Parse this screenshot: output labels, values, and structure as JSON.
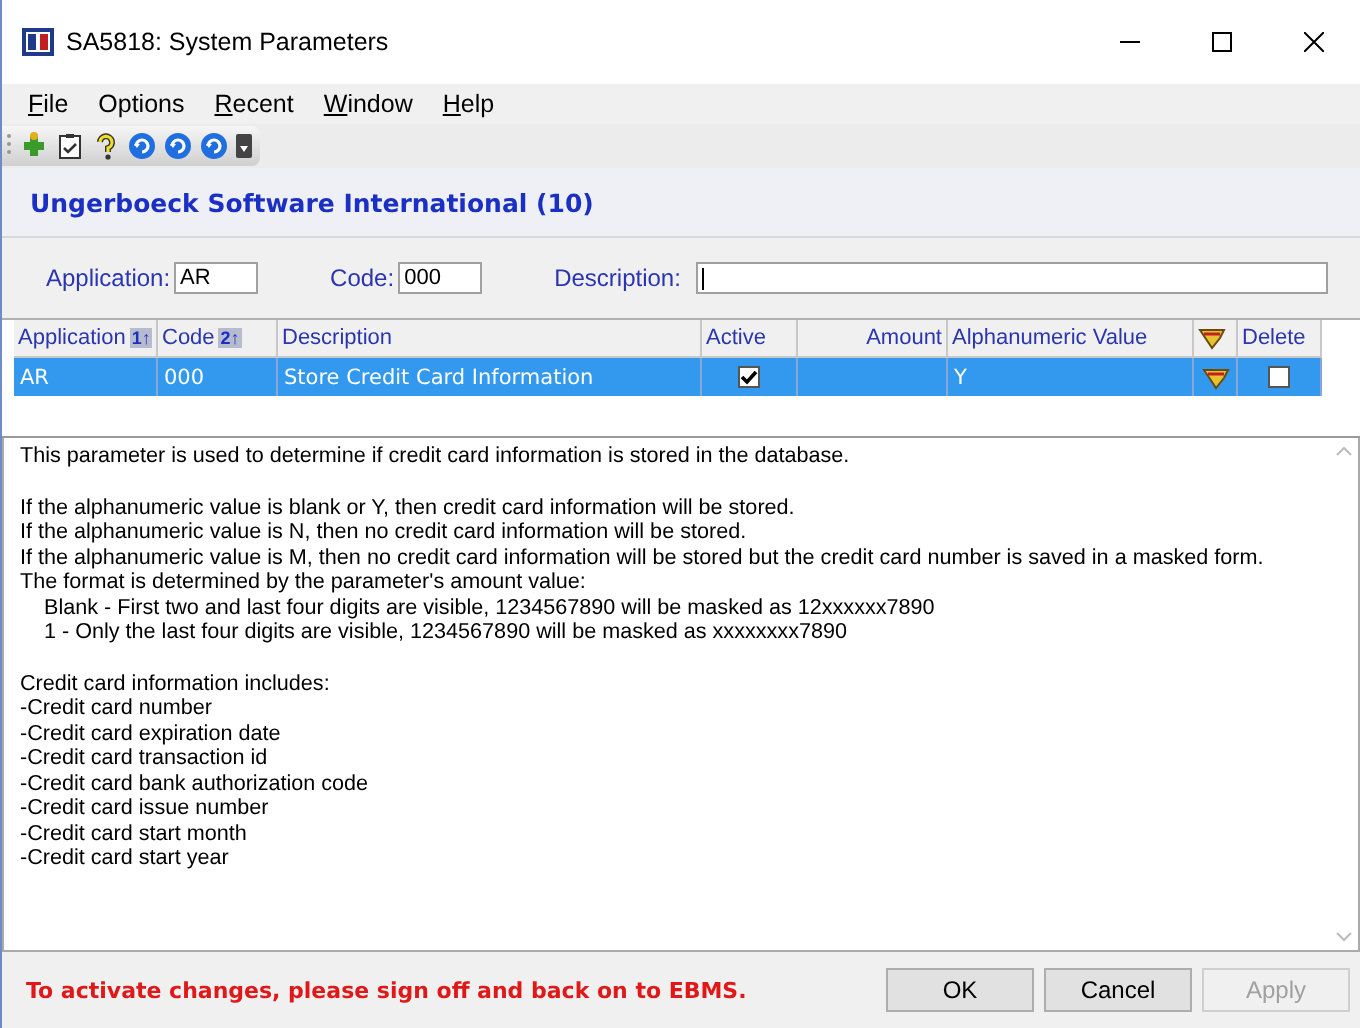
{
  "window": {
    "title": "SA5818: System Parameters"
  },
  "menu": [
    {
      "label": "File",
      "underlined": true
    },
    {
      "label": "Options",
      "underlined": false
    },
    {
      "label": "Recent",
      "underlined": true
    },
    {
      "label": "Window",
      "underlined": true
    },
    {
      "label": "Help",
      "underlined": true
    }
  ],
  "heading": "Ungerboeck Software International (10)",
  "filters": [
    {
      "label": "Application:",
      "value": "AR",
      "kind": "short"
    },
    {
      "label": "Code:",
      "value": "000",
      "kind": "short"
    },
    {
      "label": "Description:",
      "kind": "wide"
    }
  ],
  "table": {
    "columns": [
      {
        "label": "Application",
        "sort": "1↑",
        "kind": "text"
      },
      {
        "label": "Code",
        "sort": "2↑",
        "kind": "text"
      },
      {
        "label": "Description",
        "kind": "text"
      },
      {
        "label": "Active",
        "kind": "text"
      },
      {
        "label": "Amount",
        "kind": "number"
      },
      {
        "label": "Alphanumeric Value",
        "kind": "text"
      },
      {
        "kind": "icon"
      },
      {
        "label": "Delete",
        "kind": "text"
      }
    ],
    "rows": [
      {
        "selected": true,
        "application": "AR",
        "code": "000",
        "description": "Store Credit Card Information",
        "active": true,
        "alphanumeric_value": "Y",
        "delete": false
      }
    ]
  },
  "details": [
    [
      "This parameter is used to determine if credit card information is stored in the database."
    ],
    [
      "If the alphanumeric value is blank or Y, then credit card information will be stored.",
      "If the alphanumeric value is N, then no credit card information will be stored.",
      "If the alphanumeric value is M, then no credit card information will be stored but the credit card number is saved in a masked form.    The format is determined by the parameter's amount value:",
      "    Blank - First two and last four digits are visible, 1234567890 will be masked as 12xxxxxx7890",
      "    1 - Only the last four digits are visible, 1234567890 will be masked as xxxxxxxx7890"
    ],
    [
      "Credit card information includes:",
      "-Credit card number",
      "-Credit card expiration date",
      "-Credit card transaction id",
      "-Credit card bank authorization code",
      "-Credit card issue number",
      "-Credit card start month",
      "-Credit card start year"
    ]
  ],
  "notice": "To activate changes, please sign off and back on to EBMS.",
  "buttons": [
    {
      "label": "OK",
      "disabled": false
    },
    {
      "label": "Cancel",
      "disabled": false
    },
    {
      "label": "Apply",
      "disabled": true
    }
  ]
}
